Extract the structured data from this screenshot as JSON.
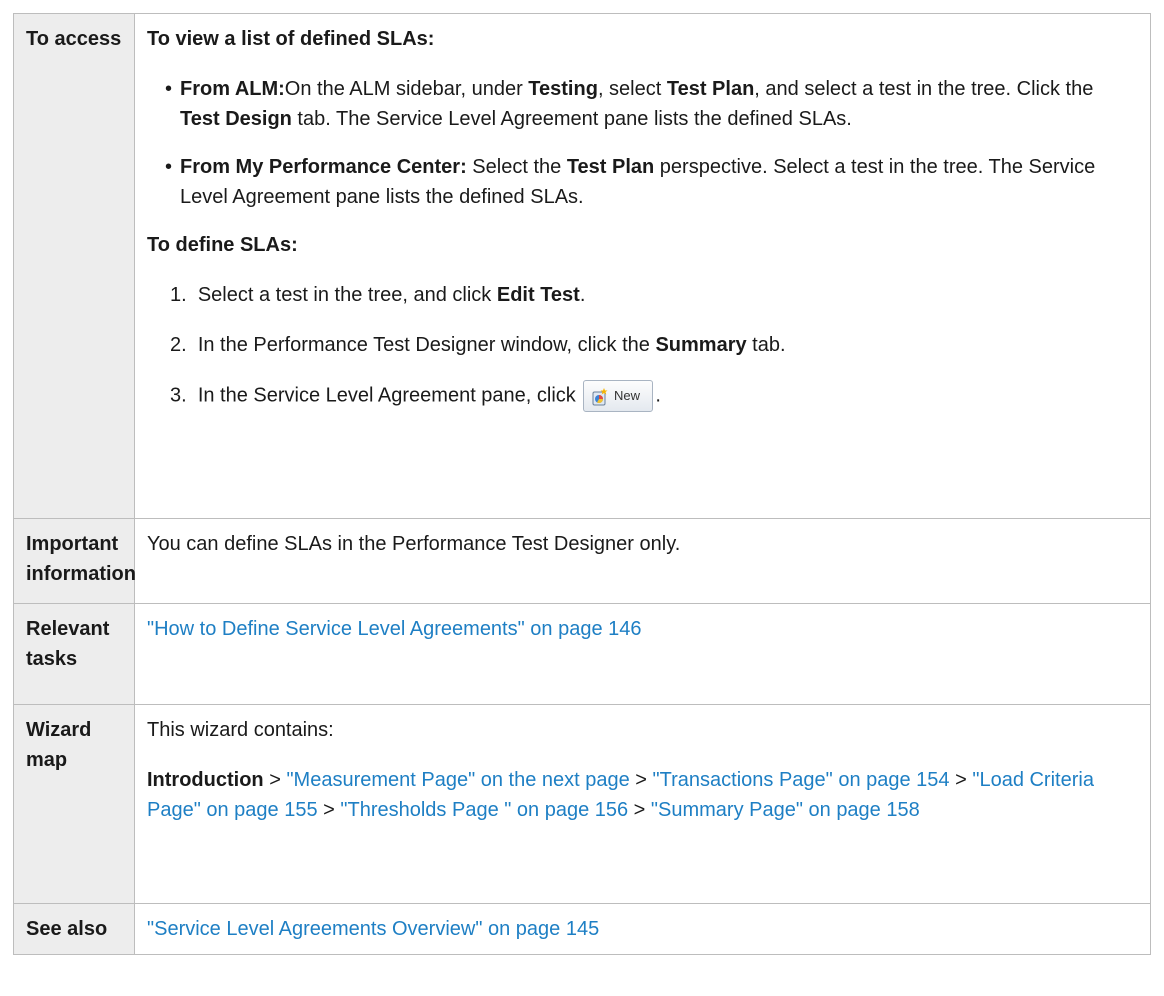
{
  "rows": {
    "access": {
      "label": "To access",
      "view_heading": "To view a list of defined SLAs:",
      "bullets": [
        {
          "b1": "From ALM:",
          "t1": "On the ALM sidebar, under ",
          "b2": "Testing",
          "t2": ", select ",
          "b3": "Test Plan",
          "t3": ", and select a test in the tree. Click the ",
          "b4": "Test Design",
          "t4": " tab. The Service Level Agreement pane lists the defined SLAs."
        },
        {
          "b1": "From My Performance Center:",
          "t1": " Select the ",
          "b2": "Test Plan",
          "t2": " perspective. Select a test in the tree. The Service Level Agreement pane lists the defined SLAs."
        }
      ],
      "define_heading": "To define SLAs:",
      "steps": [
        {
          "num": "1.",
          "t1": "Select a test in the tree, and click ",
          "b1": "Edit Test",
          "t2": "."
        },
        {
          "num": "2.",
          "t1": "In the Performance Test Designer window, click the ",
          "b1": "Summary",
          "t2": " tab."
        },
        {
          "num": "3.",
          "t1": "In the Service Level Agreement pane, click ",
          "button_label": "New",
          "t2": "."
        }
      ]
    },
    "important": {
      "label": "Important information",
      "text": "You can define SLAs in the Performance Test Designer only."
    },
    "tasks": {
      "label": "Relevant tasks",
      "link": "\"How to Define Service Level Agreements\" on page 146"
    },
    "wizard": {
      "label": "Wizard map",
      "intro": "This wizard contains:",
      "start": "Introduction",
      "sep": " > ",
      "links": [
        "\"Measurement Page\" on the next page",
        "\"Transactions Page\" on page 154",
        "\"Load Criteria Page\" on page 155",
        "\"Thresholds Page \" on page 156",
        "\"Summary Page\" on page 158"
      ]
    },
    "see_also": {
      "label": "See also",
      "link": "\"Service Level Agreements Overview\" on page 145"
    }
  },
  "colors": {
    "link": "#1e7fc4",
    "label_bg": "#ededed",
    "border": "#bdbdbd"
  },
  "icons": {
    "new_button_icon": "new-sla-icon"
  }
}
